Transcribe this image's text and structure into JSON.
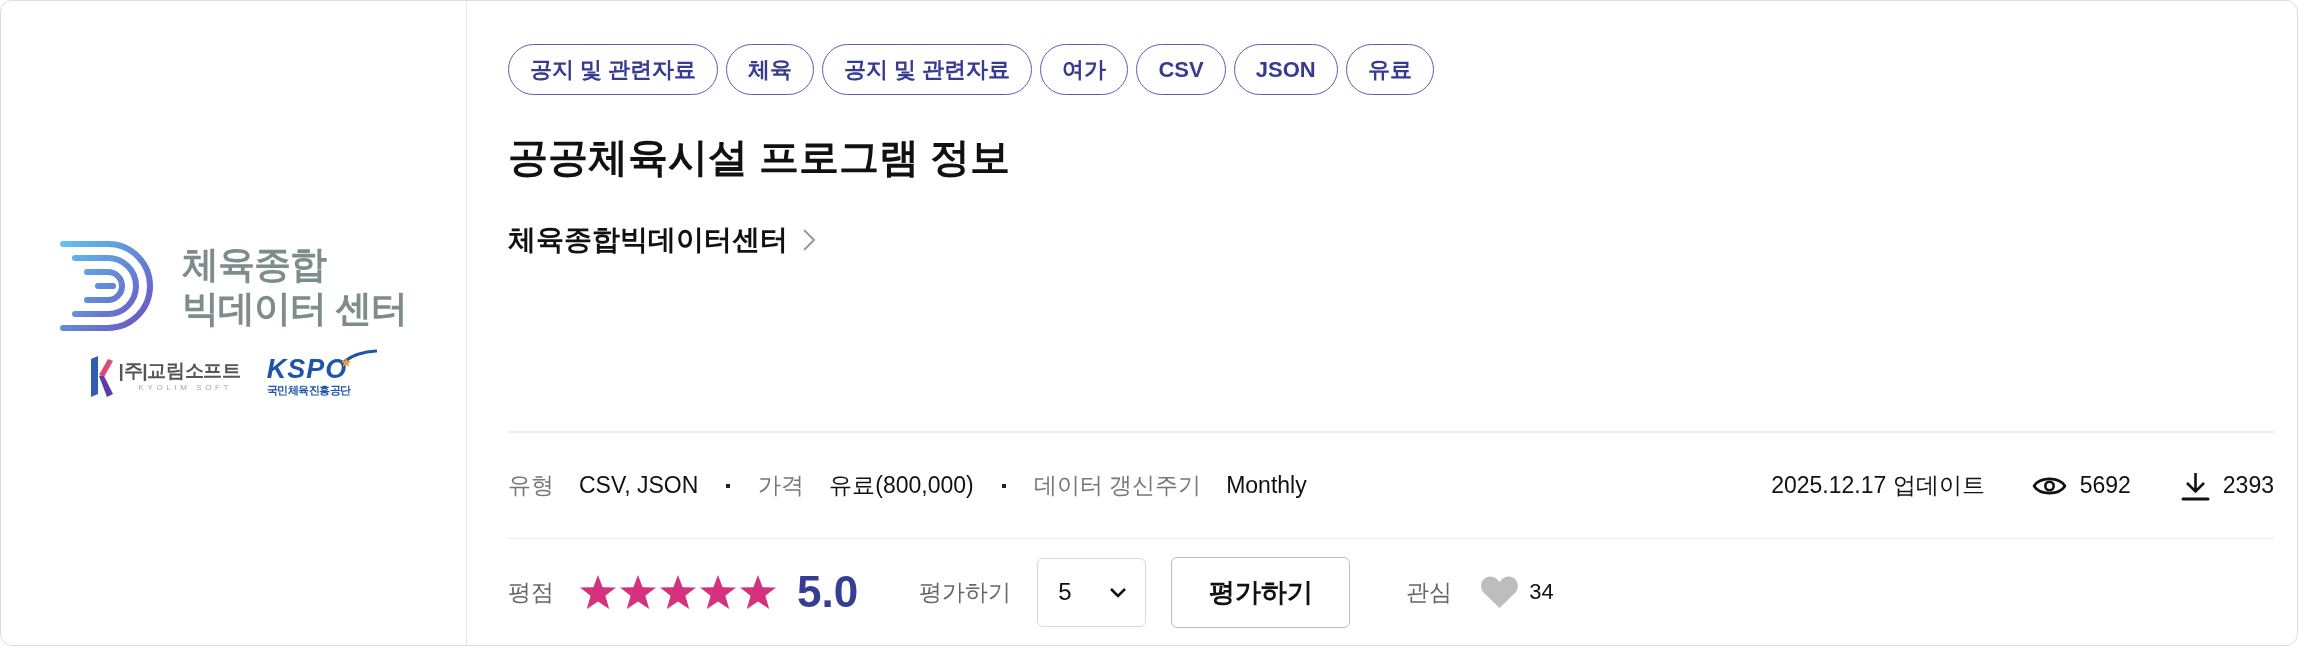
{
  "thumbnail": {
    "name_lines": [
      "체육종합",
      "빅데이터 센터"
    ],
    "partners": [
      {
        "kind": "kyolim",
        "name": "|주|교림소프트",
        "subtitle": "KYOLIM SOFT"
      },
      {
        "kind": "kspo",
        "name": "KSPO",
        "subtitle": "국민체육진흥공단"
      }
    ]
  },
  "tags": [
    "공지 및 관련자료",
    "체육",
    "공지 및 관련자료",
    "여가",
    "CSV",
    "JSON",
    "유료"
  ],
  "title": "공공체육시설 프로그램 정보",
  "publisher": "체육종합빅데이터센터",
  "meta": [
    {
      "label": "유형",
      "value": "CSV, JSON"
    },
    {
      "label": "가격",
      "value": "유료(800,000)"
    },
    {
      "label": "데이터 갱신주기",
      "value": "Monthly"
    }
  ],
  "stats": {
    "updated": "2025.12.17 업데이트",
    "views": "5692",
    "downloads": "2393"
  },
  "rating": {
    "label": "평점",
    "stars": 5,
    "score": "5.0"
  },
  "rate": {
    "label": "평가하기",
    "value": "5",
    "button": "평가하기"
  },
  "interest": {
    "label": "관심",
    "liked": false,
    "count": "34"
  }
}
